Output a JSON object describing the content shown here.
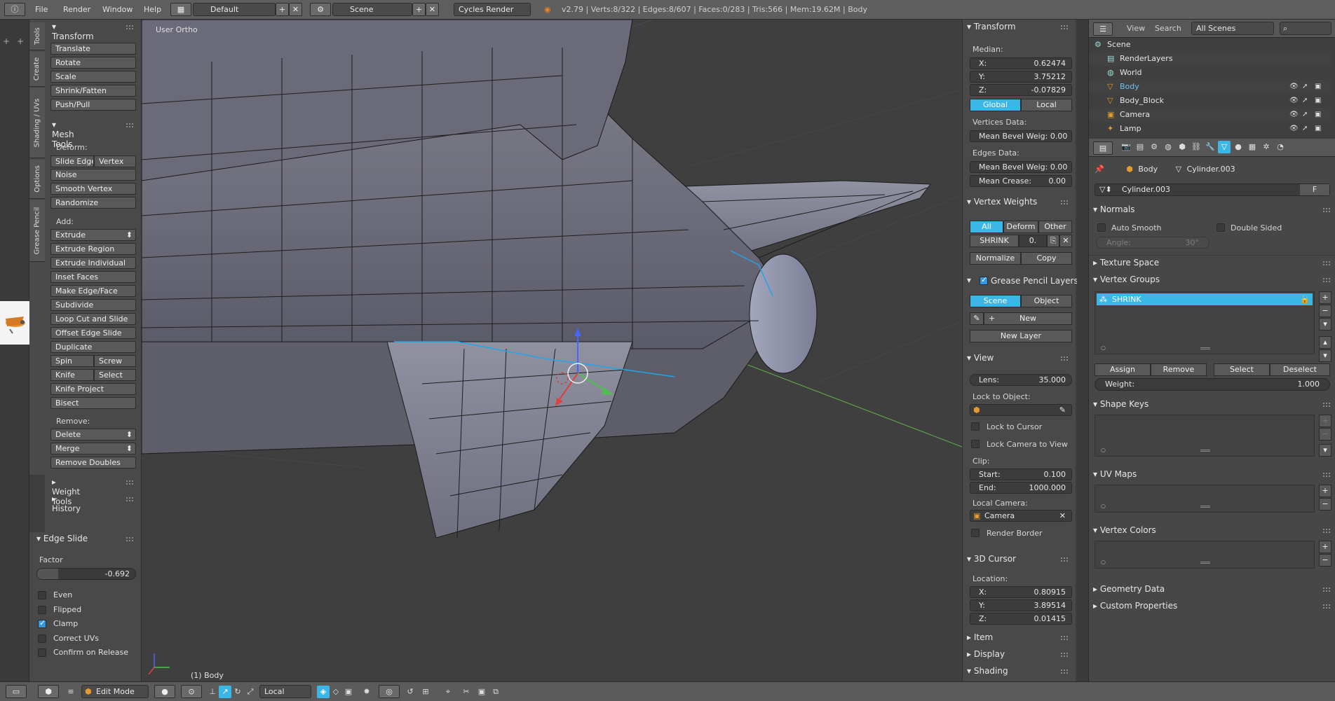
{
  "topbar": {
    "menus": [
      "File",
      "Render",
      "Window",
      "Help"
    ],
    "layout": "Default",
    "scene": "Scene",
    "engine": "Cycles Render",
    "stats": "v2.79 | Verts:8/322 | Edges:8/607 | Faces:0/283 | Tris:566 | Mem:19.62M | Body"
  },
  "vtabs": [
    "Tools",
    "Create",
    "Shading / UVs",
    "Options",
    "Grease Pencil"
  ],
  "toolshelf": {
    "transform_title": "Transform",
    "transform": [
      "Translate",
      "Rotate",
      "Scale",
      "Shrink/Fatten",
      "Push/Pull"
    ],
    "mesh_tools_title": "Mesh Tools",
    "deform_label": "Deform:",
    "slide_edge": "Slide Edge",
    "vertex": "Vertex",
    "deform": [
      "Noise",
      "Smooth Vertex",
      "Randomize"
    ],
    "add_label": "Add:",
    "extrude": "Extrude",
    "add": [
      "Extrude Region",
      "Extrude Individual",
      "Inset Faces",
      "Make Edge/Face",
      "Subdivide",
      "Loop Cut and Slide",
      "Offset Edge Slide",
      "Duplicate"
    ],
    "spin": "Spin",
    "screw": "Screw",
    "knife": "Knife",
    "select": "Select",
    "knife_project": "Knife Project",
    "bisect": "Bisect",
    "remove_label": "Remove:",
    "delete": "Delete",
    "merge": "Merge",
    "remove_doubles": "Remove Doubles",
    "weight_tools": "Weight Tools",
    "history": "History"
  },
  "operator": {
    "title": "Edge Slide",
    "factor_label": "Factor",
    "factor_value": "-0.692",
    "options": [
      {
        "label": "Even",
        "checked": false
      },
      {
        "label": "Flipped",
        "checked": false
      },
      {
        "label": "Clamp",
        "checked": true
      },
      {
        "label": "Correct UVs",
        "checked": false
      },
      {
        "label": "Confirm on Release",
        "checked": false
      }
    ]
  },
  "viewport": {
    "view_name": "User Ortho",
    "object_label": "(1) Body"
  },
  "npanel": {
    "transform_title": "Transform",
    "median": "Median:",
    "x_label": "X:",
    "x": "0.62474",
    "y_label": "Y:",
    "y": "3.75212",
    "z_label": "Z:",
    "z": "-0.07829",
    "global": "Global",
    "local": "Local",
    "vertices_data": "Vertices Data:",
    "mean_bevel_v": "Mean Bevel Weig: 0.00",
    "edges_data": "Edges Data:",
    "mean_bevel_e": "Mean Bevel Weig: 0.00",
    "mean_crease": "Mean Crease:",
    "mean_crease_val": "0.00",
    "vw_title": "Vertex Weights",
    "vw_all": "All",
    "vw_deform": "Deform",
    "vw_other": "Other",
    "vw_group": "SHRINK",
    "vw_value": "0.",
    "normalize": "Normalize",
    "copy": "Copy",
    "gp_title": "Grease Pencil Layers",
    "gp_scene": "Scene",
    "gp_object": "Object",
    "gp_new": "New",
    "gp_new_layer": "New Layer",
    "view_title": "View",
    "lens_label": "Lens:",
    "lens": "35.000",
    "lock_obj": "Lock to Object:",
    "lock_cursor": "Lock to Cursor",
    "lock_camera": "Lock Camera to View",
    "clip": "Clip:",
    "start_label": "Start:",
    "start": "0.100",
    "end_label": "End:",
    "end": "1000.000",
    "local_camera": "Local Camera:",
    "camera": "Camera",
    "render_border": "Render Border",
    "cursor_title": "3D Cursor",
    "location": "Location:",
    "cx": "0.80915",
    "cy": "3.89514",
    "cz": "0.01415",
    "item": "Item",
    "display": "Display",
    "shading": "Shading"
  },
  "outliner": {
    "view": "View",
    "search": "Search",
    "scenes": "All Scenes",
    "rows": [
      "Scene",
      "RenderLayers",
      "World",
      "Body",
      "Body_Block",
      "Camera",
      "Lamp"
    ]
  },
  "props": {
    "crumb_obj": "Body",
    "crumb_mesh": "Cylinder.003",
    "mesh_name": "Cylinder.003",
    "fake": "F",
    "normals": "Normals",
    "auto_smooth": "Auto Smooth",
    "double_sided": "Double Sided",
    "angle_label": "Angle:",
    "angle": "30°",
    "texture_space": "Texture Space",
    "vertex_groups": "Vertex Groups",
    "vg_item": "SHRINK",
    "assign": "Assign",
    "remove": "Remove",
    "select": "Select",
    "deselect": "Deselect",
    "weight_label": "Weight:",
    "weight": "1.000",
    "shape_keys": "Shape Keys",
    "uv_maps": "UV Maps",
    "vertex_colors": "Vertex Colors",
    "geometry_data": "Geometry Data",
    "custom_props": "Custom Properties"
  },
  "bottombar": {
    "mode": "Edit Mode",
    "orientation": "Local"
  },
  "colors": {
    "accent": "#3ab7e6",
    "selected_edge": "#1fa6e8",
    "x_axis": "#d44",
    "y_axis": "#4c4",
    "z_axis": "#46f"
  }
}
